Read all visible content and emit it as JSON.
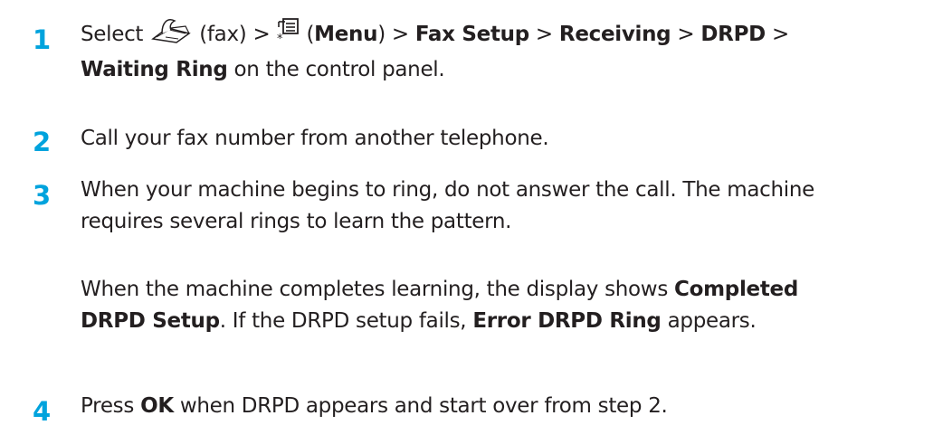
{
  "steps": [
    {
      "number": "1",
      "line1": {
        "select": "Select",
        "fax_label": "(fax) >",
        "menu_open": "(",
        "menu_bold": "Menu",
        "menu_close": ") >",
        "fax_setup": "Fax Setup",
        "sep1": ">",
        "receiving": "Receiving",
        "sep2": ">",
        "drpd": "DRPD",
        "sep3": ">"
      },
      "line2": {
        "waiting_ring": "Waiting Ring",
        "rest": "on the control panel."
      },
      "icons": [
        "fax-icon",
        "menu-icon"
      ]
    },
    {
      "number": "2",
      "text": "Call your fax number from another telephone."
    },
    {
      "number": "3",
      "line1": "When your machine begins to ring, do not answer the call. The machine",
      "line2": "requires several rings to learn the pattern.",
      "para2": {
        "a": "When the machine completes learning, the display shows",
        "b_bold": "Completed",
        "c_bold": "DRPD Setup",
        "d": ". If the DRPD setup fails,",
        "e_bold": "Error DRPD Ring",
        "f": "appears."
      }
    },
    {
      "number": "4",
      "a": "Press",
      "b_bold": "OK",
      "c": "when DRPD appears and start over from step 2."
    }
  ],
  "colors": {
    "step_number": "#00a3dd",
    "text": "#231f20"
  }
}
